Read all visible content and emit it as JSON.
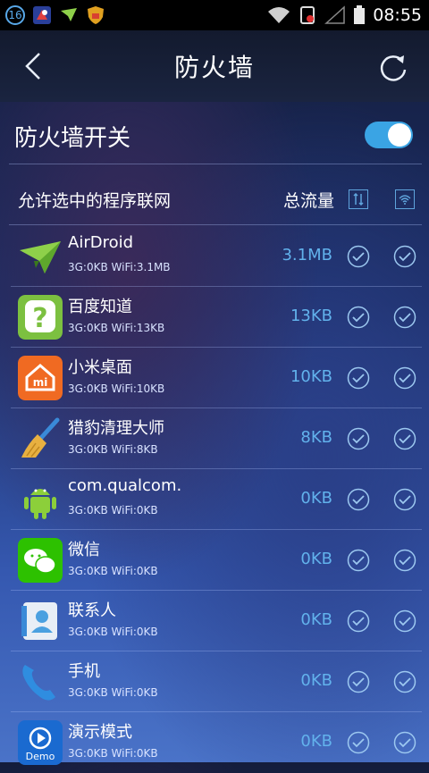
{
  "statusbar": {
    "badge": "16",
    "time": "08:55"
  },
  "header": {
    "title": "防火墙"
  },
  "firewall_switch": {
    "label": "防火墙开关",
    "on": true
  },
  "list_header": {
    "label": "允许选中的程序联网",
    "total": "总流量"
  },
  "apps": [
    {
      "name": "AirDroid",
      "sub": "3G:0KB WiFi:3.1MB",
      "traffic": "3.1MB",
      "icon": "airdroid-icon",
      "mobile_allowed": true,
      "wifi_allowed": true
    },
    {
      "name": "百度知道",
      "sub": "3G:0KB WiFi:13KB",
      "traffic": "13KB",
      "icon": "baidu-zhidao-icon",
      "mobile_allowed": true,
      "wifi_allowed": true
    },
    {
      "name": "小米桌面",
      "sub": "3G:0KB WiFi:10KB",
      "traffic": "10KB",
      "icon": "mi-launcher-icon",
      "mobile_allowed": true,
      "wifi_allowed": true
    },
    {
      "name": "猎豹清理大师",
      "sub": "3G:0KB WiFi:8KB",
      "traffic": "8KB",
      "icon": "broom-icon",
      "mobile_allowed": true,
      "wifi_allowed": true
    },
    {
      "name": "com.qualcom.",
      "sub": "3G:0KB WiFi:0KB",
      "traffic": "0KB",
      "icon": "android-icon",
      "mobile_allowed": true,
      "wifi_allowed": true
    },
    {
      "name": "微信",
      "sub": "3G:0KB WiFi:0KB",
      "traffic": "0KB",
      "icon": "wechat-icon",
      "mobile_allowed": true,
      "wifi_allowed": true
    },
    {
      "name": "联系人",
      "sub": "3G:0KB WiFi:0KB",
      "traffic": "0KB",
      "icon": "contacts-icon",
      "mobile_allowed": true,
      "wifi_allowed": true
    },
    {
      "name": "手机",
      "sub": "3G:0KB WiFi:0KB",
      "traffic": "0KB",
      "icon": "phone-icon",
      "mobile_allowed": true,
      "wifi_allowed": true
    },
    {
      "name": "演示模式",
      "sub": "3G:0KB WiFi:0KB",
      "traffic": "0KB",
      "icon": "demo-icon",
      "icon_text": "Demo",
      "mobile_allowed": true,
      "wifi_allowed": true
    }
  ]
}
